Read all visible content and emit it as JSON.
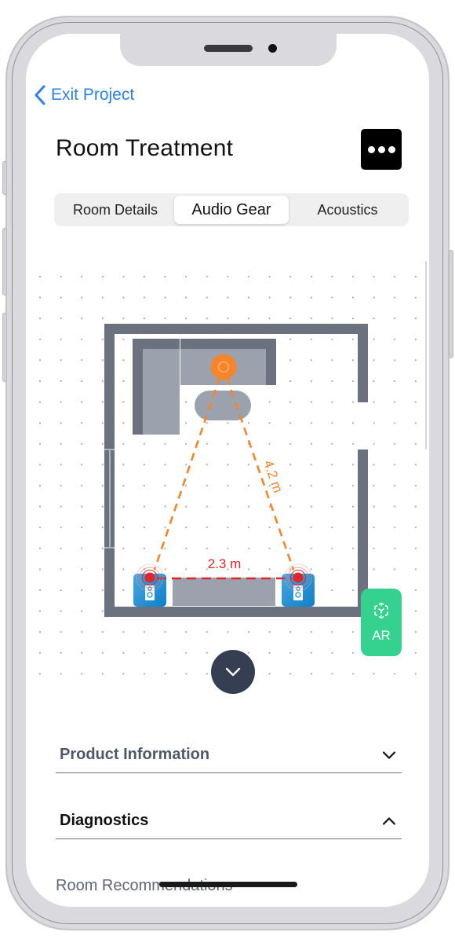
{
  "nav": {
    "back_label": "Exit Project",
    "back_icon": "chevron-left-icon",
    "accent_color": "#2f80e4"
  },
  "header": {
    "title": "Room Treatment",
    "more_icon": "ellipsis-icon"
  },
  "tabs": [
    {
      "label": "Room Details",
      "selected": false
    },
    {
      "label": "Audio Gear",
      "selected": true
    },
    {
      "label": "Acoustics",
      "selected": false
    }
  ],
  "floor_plan": {
    "listening_distance_label": "4.2 m",
    "speaker_spacing_label": "2.3 m",
    "colors": {
      "wall": "#6b717f",
      "furniture": "#9ca2ad",
      "listener": "#f5842b",
      "speaker": "#1e8fd5",
      "speaker_dot": "#e0262b",
      "spacing_line": "#e0262b",
      "triangle_line": "#f5842b"
    }
  },
  "ar_button": {
    "label": "AR",
    "icon": "ar-cube-icon",
    "color": "#35d18f"
  },
  "collapse_button": {
    "icon": "chevron-down-icon"
  },
  "sections": [
    {
      "label": "Product Information",
      "expanded": false,
      "icon": "chevron-down-icon"
    },
    {
      "label": "Diagnostics",
      "expanded": true,
      "icon": "chevron-up-icon"
    }
  ],
  "diagnostics_items": [
    {
      "label": "Room Recommendations"
    }
  ]
}
